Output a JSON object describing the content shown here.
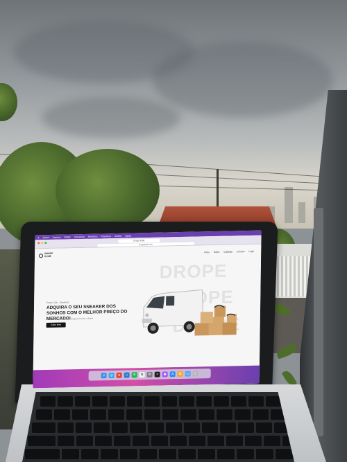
{
  "menubar": {
    "items": [
      "Safari",
      "Arquivo",
      "Editar",
      "Visualizar",
      "Histórico",
      "Favoritos",
      "Janela",
      "Ajuda"
    ]
  },
  "browser": {
    "tab_title": "Drops Club",
    "url": "dropsclub.com"
  },
  "website": {
    "logo_line1": "DROPS",
    "logo_line2": "CLUB",
    "nav": [
      "Início",
      "Sobre",
      "Catálogo",
      "Contato",
      "Login"
    ],
    "background_words": [
      "DROPE",
      "DROPE",
      "DROPE"
    ],
    "hero_kicker": "Drops Club · Sneakers",
    "hero_title": "ADQUIRA O SEU SNEAKER DOS SONHOS COM O MELHOR PREÇO DO MERCADO!",
    "hero_sub": "Os melhores pares com entrega para todo o Brasil",
    "cta_label": "Saiba Mais"
  },
  "dock": {
    "icons": [
      {
        "name": "finder-icon",
        "color": "#3d8ff0",
        "glyph": "☺"
      },
      {
        "name": "safari-icon",
        "color": "#2fa6ee",
        "glyph": "◎"
      },
      {
        "name": "chrome-icon",
        "color": "#e0483a",
        "glyph": "●"
      },
      {
        "name": "vscode-icon",
        "color": "#2b7fd3",
        "glyph": "‹›"
      },
      {
        "name": "spotify-icon",
        "color": "#1db954",
        "glyph": "≋"
      },
      {
        "name": "notion-icon",
        "color": "#f2f2f2",
        "glyph": "N"
      },
      {
        "name": "settings-icon",
        "color": "#7c7c82",
        "glyph": "⚙"
      },
      {
        "name": "terminal-icon",
        "color": "#222222",
        "glyph": ">"
      },
      {
        "name": "figma-icon",
        "color": "#a259ff",
        "glyph": "◆"
      },
      {
        "name": "appstore-icon",
        "color": "#2f8cf4",
        "glyph": "A"
      },
      {
        "name": "photos-icon",
        "color": "#f5a623",
        "glyph": "✿"
      },
      {
        "name": "folder-icon",
        "color": "#57a7ef",
        "glyph": "▭"
      },
      {
        "name": "trash-icon",
        "color": "#b5b5ba",
        "glyph": "▯"
      }
    ]
  }
}
